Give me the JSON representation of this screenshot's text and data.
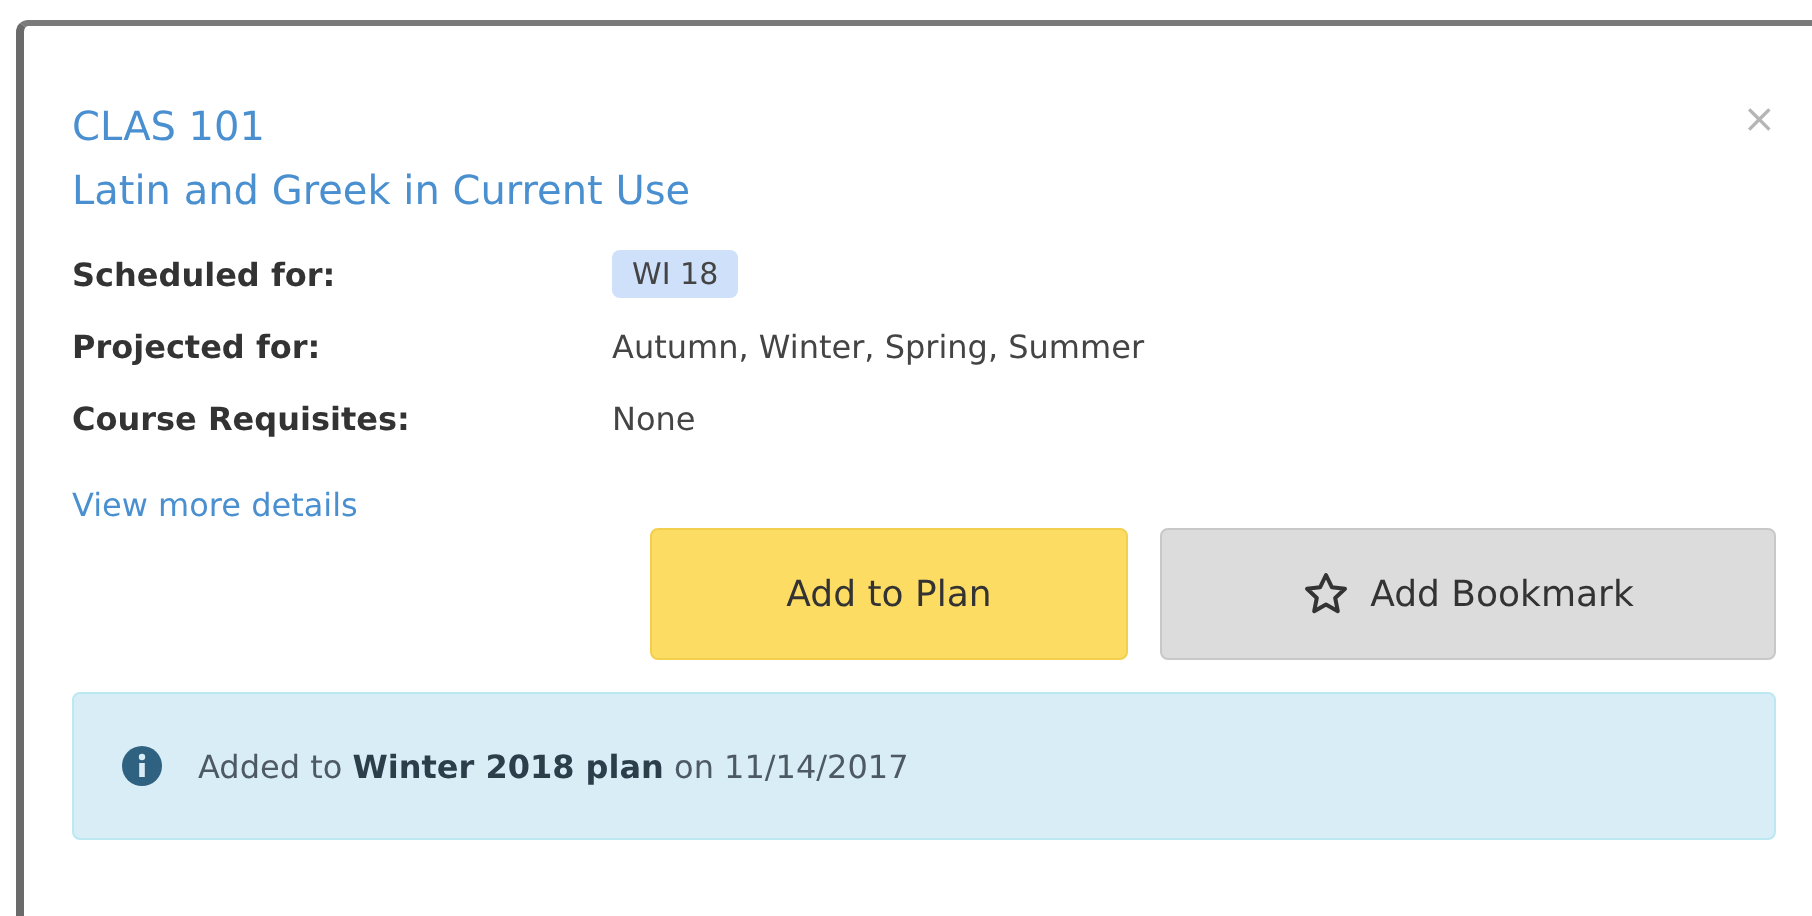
{
  "dialog": {
    "course_code": "CLAS 101",
    "course_title": "Latin and Greek in Current Use",
    "close": "×"
  },
  "details": [
    {
      "label": "Scheduled for:",
      "kind": "tag",
      "value": "WI 18"
    },
    {
      "label": "Projected for:",
      "kind": "text",
      "value": "Autumn, Winter, Spring, Summer"
    },
    {
      "label": "Course Requisites:",
      "kind": "text",
      "value": "None"
    }
  ],
  "link": "View more details",
  "buttons": [
    {
      "label": "Add to Plan",
      "kind": "primary"
    },
    {
      "label": "Add Bookmark",
      "kind": "bookmark"
    }
  ],
  "alert": {
    "text": "Added to **Winter 2018 plan** on 11/14/2017"
  }
}
